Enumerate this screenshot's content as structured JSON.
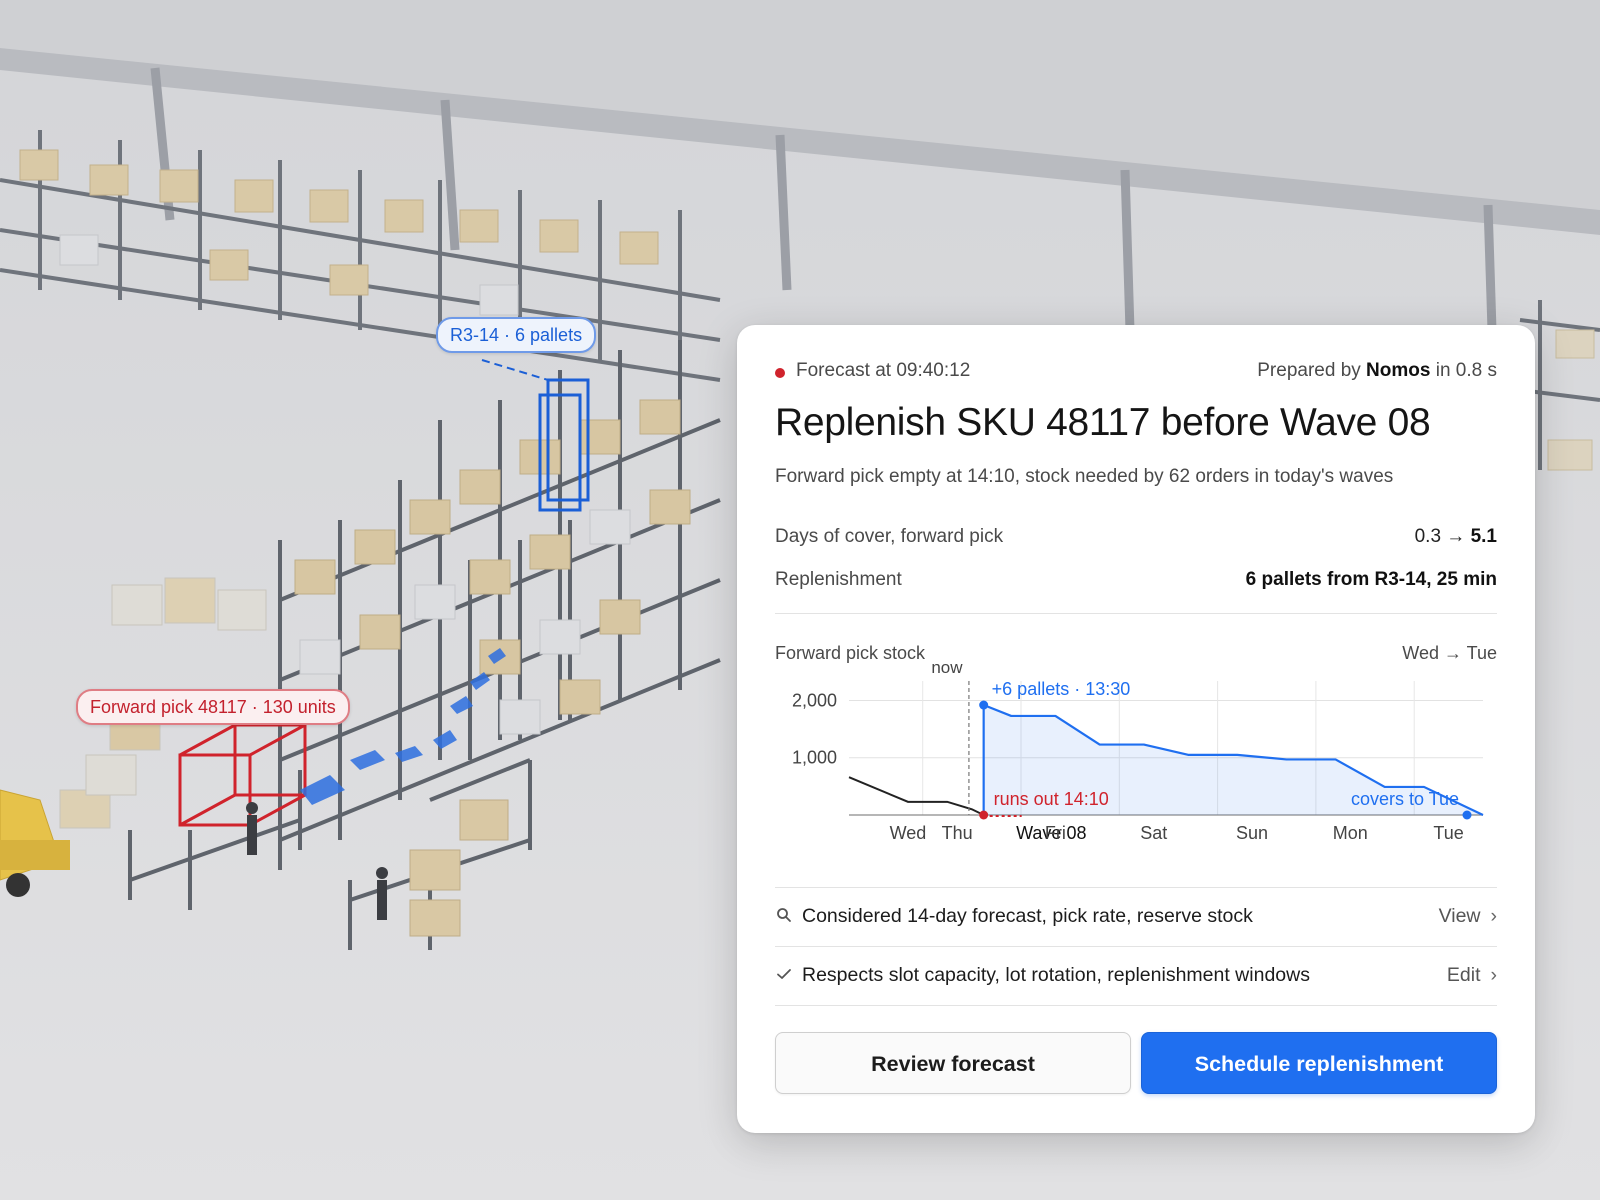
{
  "scene": {
    "labels": {
      "reserve": "R3-14 · 6 pallets",
      "forward_pick": "Forward pick 48117 · 130 units"
    },
    "colors": {
      "reserve": "#1b5fd6",
      "forward_pick": "#c3212d"
    }
  },
  "card": {
    "forecast_time": "Forecast at 09:40:12",
    "prepared_prefix": "Prepared by",
    "prepared_agent": "Nomos",
    "prepared_suffix": "in 0.8 s",
    "title": "Replenish SKU 48117 before Wave 08",
    "subtitle": "Forward pick empty at 14:10, stock needed by 62 orders in today's waves",
    "metrics": {
      "cover_label": "Days of cover, forward pick",
      "cover_from": "0.3",
      "cover_arrow": "→",
      "cover_to": "5.1",
      "replenishment_label": "Replenishment",
      "replenishment_value": "6 pallets from R3-14, 25 min"
    },
    "chart_heading": "Forward pick stock",
    "chart_range": "Wed → Tue",
    "checks": [
      {
        "icon": "search-icon",
        "text": "Considered 14-day forecast, pick rate, reserve stock",
        "link": "View"
      },
      {
        "icon": "check-icon",
        "text": "Respects slot capacity, lot rotation, replenishment windows",
        "link": "Edit"
      }
    ],
    "buttons": {
      "secondary": "Review forecast",
      "primary": "Schedule replenishment"
    },
    "accent": "#1f6ff0",
    "alert": "#d0232c"
  },
  "chart_data": {
    "type": "line",
    "title": "Forward pick stock",
    "y_ticks": [
      {
        "value": 1000,
        "label": "1,000"
      },
      {
        "value": 2000,
        "label": "2,000"
      }
    ],
    "ylim": [
      0,
      2200
    ],
    "x_ticks": [
      {
        "x": 0.5,
        "label": "Wed"
      },
      {
        "x": 1.0,
        "label": "Thu"
      },
      {
        "x": 1.6,
        "label": "Wave 08",
        "emphasis": true
      },
      {
        "x": 2.0,
        "label": "Fri"
      },
      {
        "x": 3.0,
        "label": "Sat"
      },
      {
        "x": 4.0,
        "label": "Sun"
      },
      {
        "x": 5.0,
        "label": "Mon"
      },
      {
        "x": 6.0,
        "label": "Tue"
      }
    ],
    "xlim": [
      -0.1,
      6.35
    ],
    "grid_x": [
      0.65,
      1.65,
      2.65,
      3.65,
      4.65,
      5.65
    ],
    "series": [
      {
        "role": "current",
        "values": [
          [
            -0.1,
            660
          ],
          [
            0.5,
            230
          ],
          [
            0.9,
            230
          ],
          [
            1.15,
            100
          ],
          [
            1.27,
            0
          ]
        ]
      },
      {
        "role": "projected",
        "values": [
          [
            1.27,
            1920
          ],
          [
            1.55,
            1730
          ],
          [
            2.0,
            1730
          ],
          [
            2.45,
            1230
          ],
          [
            2.9,
            1230
          ],
          [
            3.35,
            1050
          ],
          [
            3.85,
            1050
          ],
          [
            4.35,
            970
          ],
          [
            4.85,
            970
          ],
          [
            5.35,
            490
          ],
          [
            5.75,
            490
          ],
          [
            6.35,
            0
          ]
        ]
      }
    ],
    "now_x": 1.12,
    "annotations": {
      "now": "now",
      "replenish": "+6 pallets · 13:30",
      "runs_out": "runs out 14:10",
      "covers": "covers to Tue"
    }
  }
}
